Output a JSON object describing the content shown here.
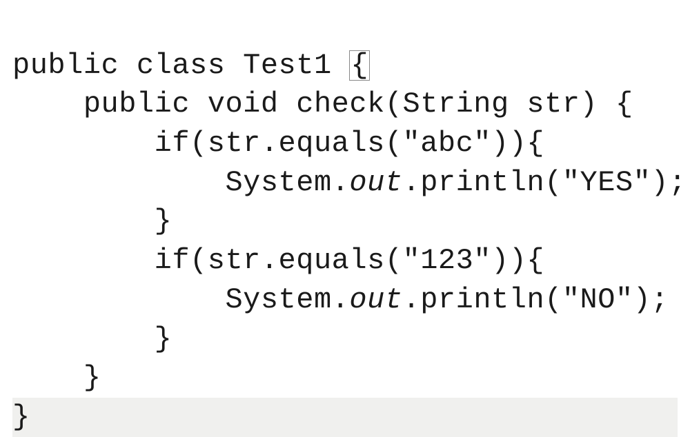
{
  "code": {
    "line1_a": "public class Test1 ",
    "line1_brace": "{",
    "line2": "    public void check(String str) {",
    "line3": "        if(str.equals(\"abc\")){",
    "line4_a": "            System.",
    "line4_out": "out",
    "line4_b": ".println(\"YES\");",
    "line5": "        }",
    "line6": "        if(str.equals(\"123\")){",
    "line7_a": "            System.",
    "line7_out": "out",
    "line7_b": ".println(\"NO\");",
    "line8": "        }",
    "line9": "    }",
    "line10": "}"
  }
}
